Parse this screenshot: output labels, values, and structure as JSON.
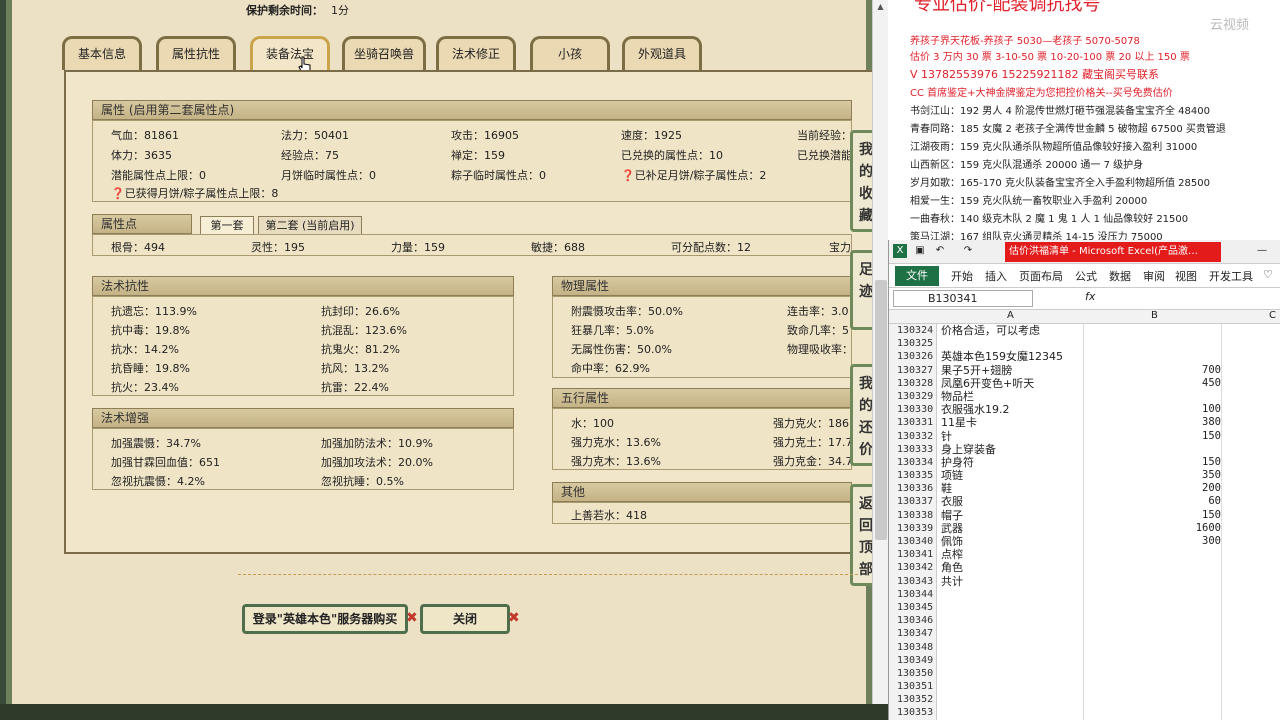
{
  "game": {
    "timer_label": "保护剩余时间：",
    "timer_value": "1分",
    "tabs": [
      "基本信息",
      "属性抗性",
      "装备法宝",
      "坐骑召唤兽",
      "法术修正",
      "小孩",
      "外观道具"
    ],
    "attr_section": {
      "title": "属性 (启用第二套属性点)",
      "rows": [
        [
          "气血：81861",
          "法力：50401",
          "攻击：16905",
          "速度：1925",
          "当前经验："
        ],
        [
          "体力：3635",
          "经验点：75",
          "禅定：159",
          "已兑换的属性点：10",
          "已兑换潜能"
        ],
        [
          "潜能属性点上限：0",
          "月饼临时属性点：0",
          "粽子临时属性点：0",
          "已补足月饼/粽子属性点：2",
          ""
        ],
        [
          "已获得月饼/粽子属性点上限：8",
          "",
          "",
          "",
          ""
        ]
      ]
    },
    "points_section": {
      "title": "属性点",
      "tab1": "第一套",
      "tab2": "第二套 (当前启用)",
      "values": [
        "根骨：494",
        "灵性：195",
        "力量：159",
        "敏捷：688",
        "可分配点数：12",
        "宝力"
      ]
    },
    "magic_resist": {
      "title": "法术抗性",
      "items": [
        [
          "抗遗忘：113.9%",
          "抗封印：26.6%"
        ],
        [
          "抗中毒：19.8%",
          "抗混乱：123.6%"
        ],
        [
          "抗水：14.2%",
          "抗鬼火：81.2%"
        ],
        [
          "抗昏睡：19.8%",
          "抗风：13.2%"
        ],
        [
          "抗火：23.4%",
          "抗雷：22.4%"
        ]
      ]
    },
    "magic_boost": {
      "title": "法术增强",
      "items": [
        [
          "加强震慑：34.7%",
          "加强加防法术：10.9%"
        ],
        [
          "加强甘霖回血值：651",
          "加强加攻法术：20.0%"
        ],
        [
          "忽视抗震慑：4.2%",
          "忽视抗睡：0.5%"
        ]
      ]
    },
    "physical": {
      "title": "物理属性",
      "items": [
        [
          "附震慑攻击率：50.0%",
          "连击率：3.0"
        ],
        [
          "狂暴几率：5.0%",
          "致命几率：5"
        ],
        [
          "无属性伤害：50.0%",
          "物理吸收率："
        ],
        [
          "命中率：62.9%",
          ""
        ]
      ]
    },
    "five_elements": {
      "title": "五行属性",
      "items": [
        [
          "水：100",
          "强力克火：186."
        ],
        [
          "强力克水：13.6%",
          "强力克土：17.7"
        ],
        [
          "强力克木：13.6%",
          "强力克金：34.7"
        ]
      ]
    },
    "other": {
      "title": "其他",
      "item": "上善若水：418"
    },
    "side_buttons": [
      "我的收藏",
      "足迹",
      "我的还价",
      "返回顶部"
    ],
    "login_button": "登录\"英雄本色\"服务器购买",
    "close_button": "关闭"
  },
  "notes": {
    "headline": "专业估价-配装调抗找号",
    "watermark": "云视频",
    "lines": [
      "养孩子界天花板-养孩子 5030—老孩子 5070-5078",
      "估价 3 万内 30 票   3-10-50 票   10-20-100 票   20 以上 150 票",
      "V 13782553976    15225921182   藏宝阁买号联系",
      "CC 首席鉴定+大神金牌鉴定为您把控价格关--买号免费估价",
      "书剑江山：192 男人 4 阶混传世燃灯砸节强混装备宝宝齐全 48400",
      "青春同路：185 女魔 2 老孩子全满传世金麟 5 破物超 67500 买贵管退",
      "江湖夜雨：159 克火队通杀队物超所值品像较好接入盈利 31000",
      "山西新区：159 克火队混通杀 20000 通一 7 级护身",
      "岁月如歌：165-170 克火队装备宝宝齐全入手盈利物超所值 28500",
      "相爱一生：159 克火队统一畜牧职业入手盈利 20000",
      "一曲春秋：140 级克木队 2 魔 1 鬼 1 人 1 仙品像较好 21500",
      "策马江湖：167 组队克火通灵精杀 14-15 没压力 75000"
    ]
  },
  "excel": {
    "title": "估价洪福清单 - Microsoft Excel(产品激…",
    "menu": [
      "文件",
      "开始",
      "插入",
      "页面布局",
      "公式",
      "数据",
      "审阅",
      "视图",
      "开发工具"
    ],
    "name_box": "B130341",
    "fx": "fx",
    "columns": [
      "A",
      "B",
      "C"
    ],
    "rows": [
      {
        "n": "130324",
        "a": "价格合适，可以考虑",
        "b": ""
      },
      {
        "n": "130325",
        "a": "",
        "b": ""
      },
      {
        "n": "130326",
        "a": "英雄本色159女魔12345",
        "b": ""
      },
      {
        "n": "130327",
        "a": "果子5开+翅膀",
        "b": "700"
      },
      {
        "n": "130328",
        "a": "凤凰6开变色+听天",
        "b": "450"
      },
      {
        "n": "130329",
        "a": "物品栏",
        "b": ""
      },
      {
        "n": "130330",
        "a": "衣服强水19.2",
        "b": "100"
      },
      {
        "n": "130331",
        "a": "11星卡",
        "b": "380"
      },
      {
        "n": "130332",
        "a": "针",
        "b": "150"
      },
      {
        "n": "130333",
        "a": "身上穿装备",
        "b": ""
      },
      {
        "n": "130334",
        "a": "护身符",
        "b": "150"
      },
      {
        "n": "130335",
        "a": "项链",
        "b": "350"
      },
      {
        "n": "130336",
        "a": "鞋",
        "b": "200"
      },
      {
        "n": "130337",
        "a": "衣服",
        "b": "60"
      },
      {
        "n": "130338",
        "a": "帽子",
        "b": "150"
      },
      {
        "n": "130339",
        "a": "武器",
        "b": "1600"
      },
      {
        "n": "130340",
        "a": "佩饰",
        "b": "300"
      },
      {
        "n": "130341",
        "a": "点榨",
        "b": ""
      },
      {
        "n": "130342",
        "a": "角色",
        "b": ""
      },
      {
        "n": "130343",
        "a": "共计",
        "b": ""
      },
      {
        "n": "130344",
        "a": "",
        "b": ""
      },
      {
        "n": "130345",
        "a": "",
        "b": ""
      },
      {
        "n": "130346",
        "a": "",
        "b": ""
      },
      {
        "n": "130347",
        "a": "",
        "b": ""
      },
      {
        "n": "130348",
        "a": "",
        "b": ""
      },
      {
        "n": "130349",
        "a": "",
        "b": ""
      },
      {
        "n": "130350",
        "a": "",
        "b": ""
      },
      {
        "n": "130351",
        "a": "",
        "b": ""
      },
      {
        "n": "130352",
        "a": "",
        "b": ""
      },
      {
        "n": "130353",
        "a": "",
        "b": ""
      }
    ]
  }
}
